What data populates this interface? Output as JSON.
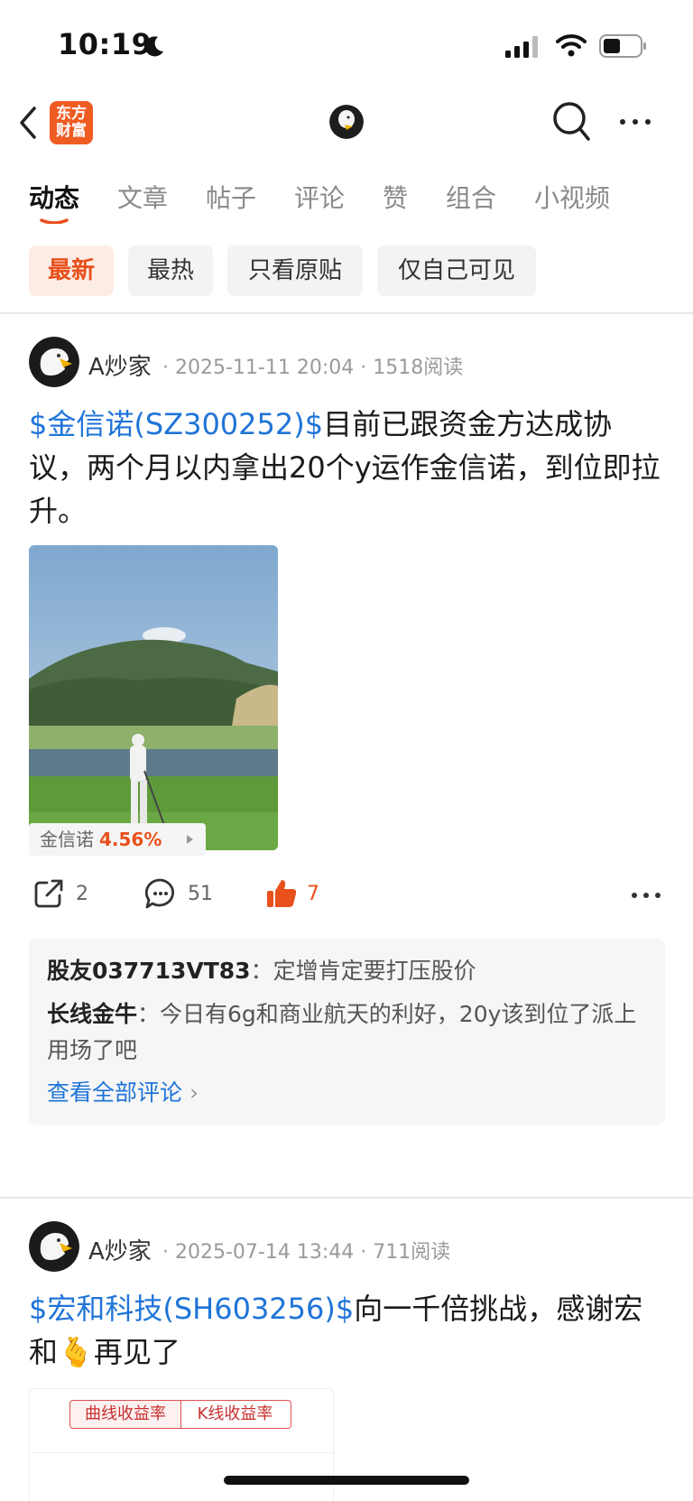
{
  "status": {
    "time": "10:19"
  },
  "nav": {
    "brand_line1": "东方",
    "brand_line2": "财富"
  },
  "tabs": [
    {
      "label": "动态",
      "active": true
    },
    {
      "label": "文章"
    },
    {
      "label": "帖子"
    },
    {
      "label": "评论"
    },
    {
      "label": "赞"
    },
    {
      "label": "组合"
    },
    {
      "label": "小视频"
    }
  ],
  "filters": [
    {
      "label": "最新",
      "active": true
    },
    {
      "label": "最热"
    },
    {
      "label": "只看原贴"
    },
    {
      "label": "仅自己可见"
    }
  ],
  "posts": [
    {
      "author": "A炒家",
      "meta": "· 2025-11-11 20:04 · 1518阅读",
      "stock_link": "$金信诺(SZ300252)$",
      "text": "目前已跟资金方达成协议，两个月以内拿出20个y运作金信诺，到位即拉升。",
      "quote_name": "金信诺",
      "quote_pct": "4.56%",
      "share_count": "2",
      "comment_count": "51",
      "like_count": "7",
      "comments": [
        {
          "user": "股友037713VT83",
          "sep": "：",
          "text": "定增肯定要打压股价"
        },
        {
          "user": "长线金牛",
          "sep": "：",
          "text": "今日有6g和商业航天的利好，20y该到位了派上用场了吧"
        }
      ],
      "view_all": "查看全部评论"
    },
    {
      "author": "A炒家",
      "meta": "· 2025-07-14 13:44 · 711阅读",
      "stock_link": "$宏和科技(SH603256)$",
      "text": "向一千倍挑战，感谢宏和🫰再见了",
      "chart_tab_1": "曲线收益率",
      "chart_tab_2": "K线收益率"
    }
  ],
  "colors": {
    "accent": "#e8501c",
    "link": "#1f74d8",
    "brand": "#ef5c22"
  }
}
